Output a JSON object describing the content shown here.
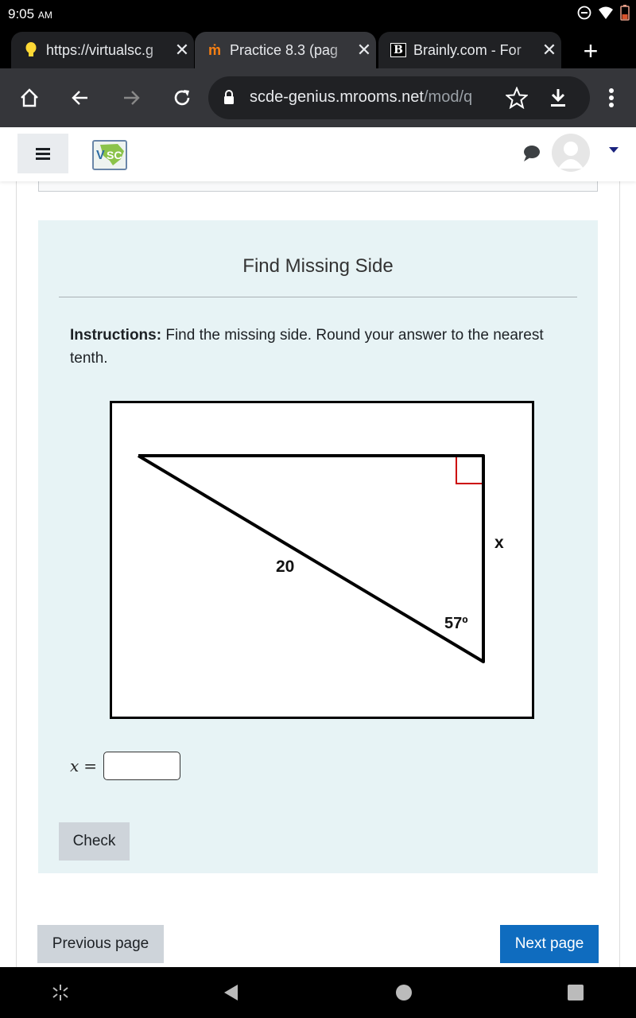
{
  "status_bar": {
    "time": "9:05",
    "ampm": "AM",
    "icons": [
      "do-not-disturb-icon",
      "wifi-icon",
      "battery-icon"
    ]
  },
  "browser": {
    "tabs": [
      {
        "title": "https://virtualsc.g",
        "favicon": "lightbulb-icon",
        "active": false
      },
      {
        "title": "Practice 8.3 (pag",
        "favicon": "moodle-icon",
        "active": true
      },
      {
        "title": "Brainly.com - For",
        "favicon": "brainly-icon",
        "active": false
      }
    ],
    "new_tab": "+",
    "url_host": "scde-genius.mrooms.net",
    "url_path": "/mod/q"
  },
  "app_header": {
    "menu_icon": "hamburger-icon",
    "logo": "VSC",
    "messages_icon": "chat-bubble-icon",
    "avatar": "user-avatar",
    "dropdown": "caret-down-icon"
  },
  "question": {
    "title": "Find Missing Side",
    "instructions_label": "Instructions:",
    "instructions_text": " Find the missing side. Round your answer to the nearest tenth.",
    "figure": {
      "hypotenuse_label": "20",
      "angle_label": "57º",
      "side_label": "x",
      "right_angle_color": "#cc0000"
    },
    "answer_label": "x",
    "answer_eq": "=",
    "answer_value": "",
    "check_label": "Check"
  },
  "navigation": {
    "previous_label": "Previous page",
    "next_label": "Next page",
    "accent_color": "#0f6cbf"
  },
  "system_nav": [
    "accessibility-icon",
    "back-icon",
    "home-icon",
    "recents-icon"
  ]
}
